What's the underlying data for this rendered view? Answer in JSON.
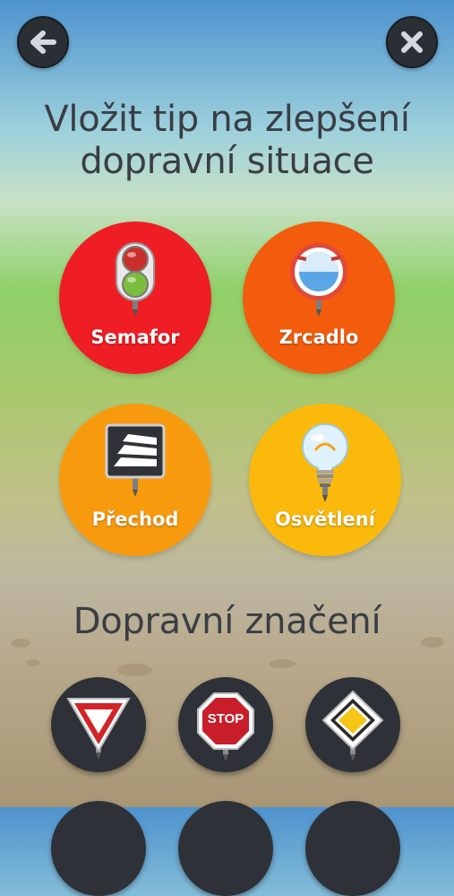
{
  "nav": {
    "back_icon": "arrow-left-icon",
    "close_icon": "close-x-icon"
  },
  "tip_section": {
    "title_line1": "Vložit tip na zlepšení",
    "title_line2": "dopravní situace"
  },
  "categories": [
    {
      "label": "Semafor",
      "icon": "traffic-light-icon",
      "color": "#ef1d24"
    },
    {
      "label": "Zrcadlo",
      "icon": "traffic-mirror-icon",
      "color": "#f25c0c"
    },
    {
      "label": "Přechod",
      "icon": "crosswalk-sign-icon",
      "color": "#f89a0e"
    },
    {
      "label": "Osvětlení",
      "icon": "light-bulb-icon",
      "color": "#fbb90c"
    }
  ],
  "signs_section": {
    "title": "Dopravní značení"
  },
  "signs": [
    {
      "icon": "yield-sign-icon"
    },
    {
      "icon": "stop-sign-icon",
      "text": "STOP"
    },
    {
      "icon": "priority-road-sign-icon"
    }
  ]
}
